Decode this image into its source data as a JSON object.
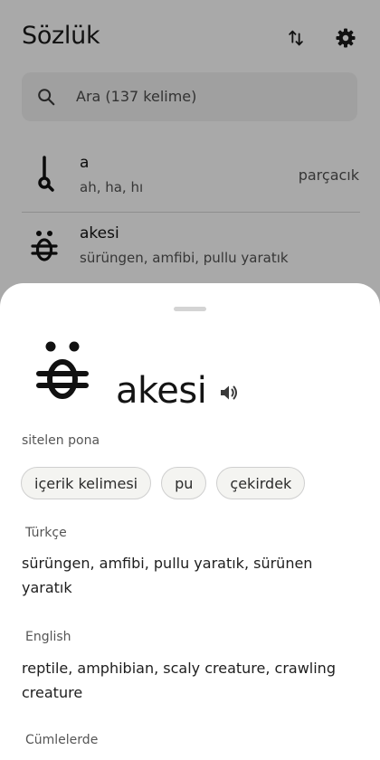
{
  "app": {
    "title": "Sözlük"
  },
  "search": {
    "placeholder": "Ara (137 kelime)"
  },
  "entries": [
    {
      "word": "a",
      "definitions": "ah, ha, hı",
      "category": "parçacık"
    },
    {
      "word": "akesi",
      "definitions": "sürüngen, amfibi, pullu yaratık",
      "category": ""
    }
  ],
  "detail": {
    "word": "akesi",
    "sitelen_label": "sitelen pona",
    "tags": [
      "içerik kelimesi",
      "pu",
      "çekirdek"
    ],
    "sections": [
      {
        "title": "Türkçe",
        "body": "sürüngen, amfibi, pullu yaratık, sürünen yaratık"
      },
      {
        "title": "English",
        "body": "reptile, amphibian, scaly creature, crawling creature"
      },
      {
        "title": "Cümlelerde",
        "body": ""
      }
    ]
  },
  "icons": {
    "sort": "sort-arrows-icon",
    "settings": "gear-icon",
    "search": "search-icon",
    "speaker": "speaker-icon"
  },
  "colors": {
    "scrim": "#000000",
    "chip_background": "#f4f4f1",
    "chip_border": "#cfcfcf",
    "sheet": "#ffffff"
  }
}
